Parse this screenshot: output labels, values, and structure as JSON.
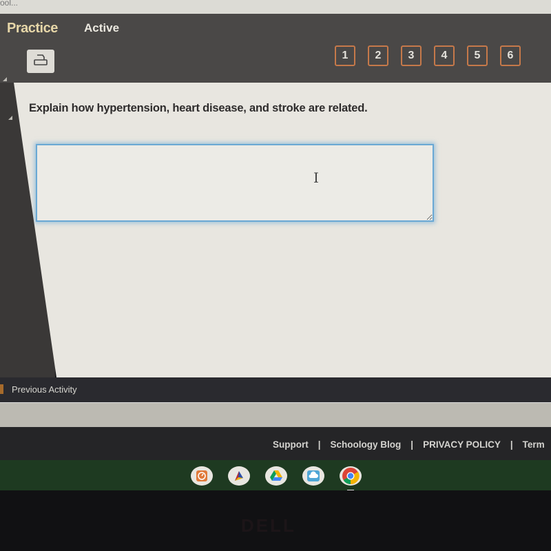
{
  "browser": {
    "tab_title_fragment": "ool..."
  },
  "header": {
    "title": "Practice",
    "status": "Active",
    "print_icon": "printer-icon",
    "question_nav": [
      "1",
      "2",
      "3",
      "4",
      "5",
      "6"
    ]
  },
  "question": {
    "prompt": "Explain how hypertension, heart disease, and stroke are related.",
    "answer_value": "",
    "cursor_icon": "text-cursor-icon"
  },
  "navigation": {
    "previous_label": "Previous Activity"
  },
  "footer": {
    "links": [
      "Support",
      "Schoology Blog",
      "PRIVACY POLICY",
      "Term"
    ],
    "separator": "|"
  },
  "shelf": {
    "apps": [
      "clock-app-icon",
      "kite-app-icon",
      "google-drive-icon",
      "cloud-app-icon",
      "chrome-icon"
    ]
  },
  "bezel": {
    "brand": "DELL"
  },
  "colors": {
    "header_bg": "#4a4847",
    "accent_orange": "#c6794a",
    "title_color": "#e6d6a8",
    "focus_blue": "#6aa8d4",
    "shelf_green": "#1e3a21"
  }
}
